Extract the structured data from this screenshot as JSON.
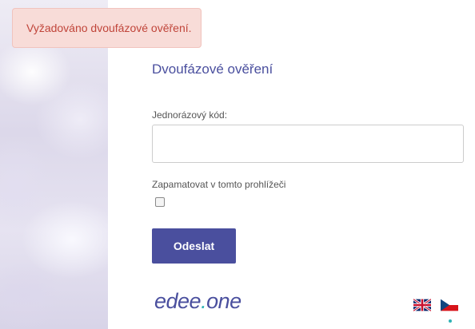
{
  "alert": {
    "message": "Vyžadováno dvoufázové ověření."
  },
  "form": {
    "title": "Dvoufázové ověření",
    "code_label": "Jednorázový kód:",
    "code_value": "",
    "remember_label": "Zapamatovat v tomto prohlížeči",
    "remember_checked": false,
    "submit_label": "Odeslat"
  },
  "logo": {
    "part1": "edee",
    "dot": ".",
    "part2": "one"
  },
  "languages": [
    {
      "code": "en",
      "icon": "uk-flag-icon"
    },
    {
      "code": "cs",
      "icon": "cz-flag-icon",
      "active": true
    }
  ],
  "colors": {
    "accent": "#4a4f9e",
    "alert_bg": "#f8dcd8",
    "alert_text": "#c0453a",
    "teal": "#2fb3b5"
  }
}
